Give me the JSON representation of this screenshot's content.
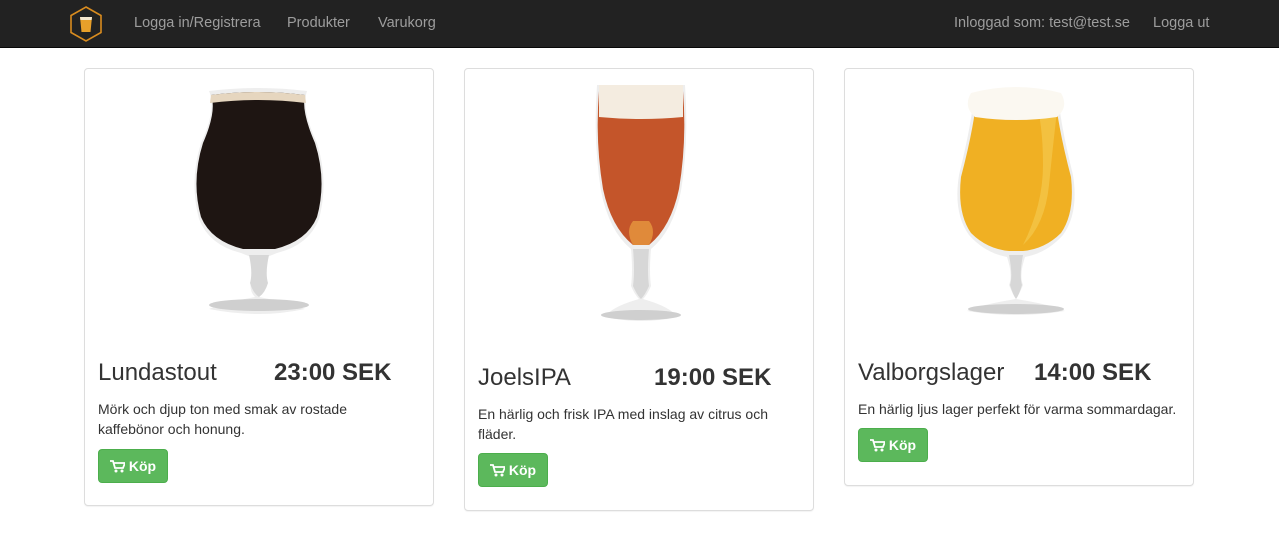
{
  "nav": {
    "brand_icon": "beer-glass-hexagon-icon",
    "login_label": "Logga in/Registrera",
    "products_label": "Produkter",
    "cart_label": "Varukorg",
    "logged_in_label": "Inloggad som: test@test.se",
    "logout_label": "Logga ut"
  },
  "colors": {
    "navbar": "#222222",
    "nav_text": "#9d9d9d",
    "buy_button": "#5cb85c"
  },
  "products": [
    {
      "name": "Lundastout",
      "price": "23:00 SEK",
      "description": "Mörk och djup ton med smak av rostade kaffebönor och honung.",
      "buy_label": "Köp",
      "beer_color": "#1e1512",
      "foam_color": "#e6d6bf"
    },
    {
      "name": "JoelsIPA",
      "price": "19:00 SEK",
      "description": "En härlig och frisk IPA med inslag av citrus och fläder.",
      "buy_label": "Köp",
      "beer_color": "#c4552a",
      "foam_color": "#f4ece0"
    },
    {
      "name": "Valborgslager",
      "price": "14:00 SEK",
      "description": "En härlig ljus lager perfekt för varma sommardagar.",
      "buy_label": "Köp",
      "beer_color": "#f0b023",
      "foam_color": "#fbf8f1"
    }
  ]
}
